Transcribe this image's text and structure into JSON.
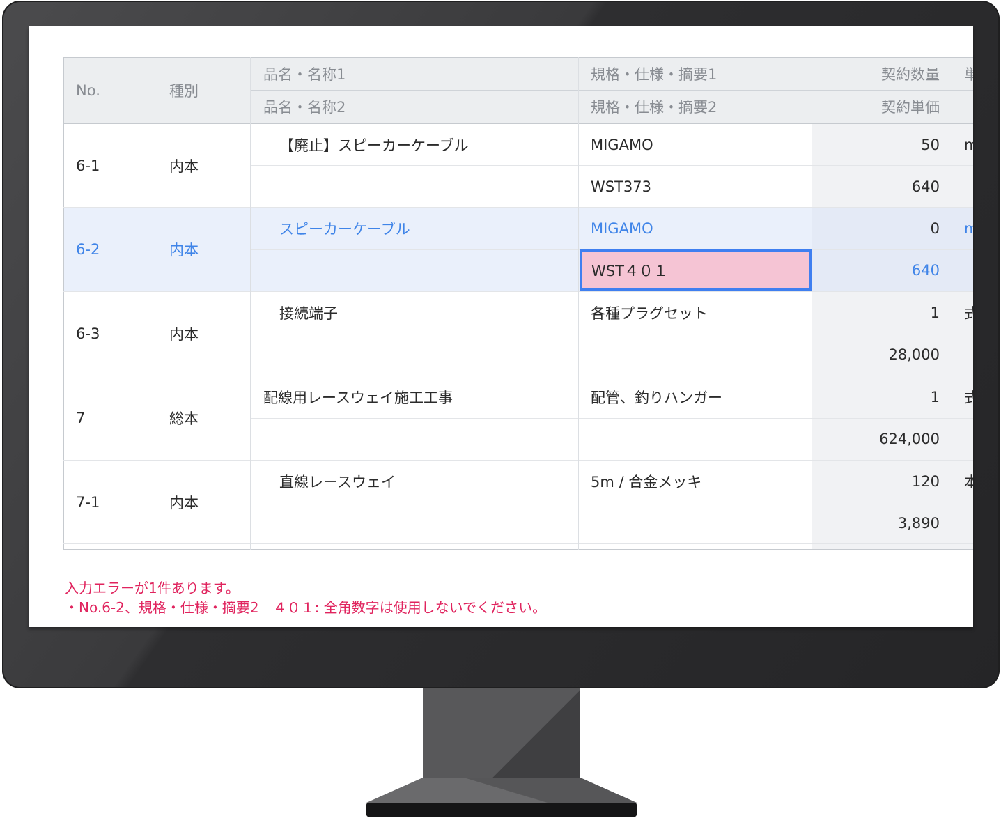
{
  "table": {
    "headers": {
      "no": "No.",
      "type": "種別",
      "name1": "品名・名称1",
      "name2": "品名・名称2",
      "spec1": "規格・仕様・摘要1",
      "spec2": "規格・仕様・摘要2",
      "qty": "契約数量",
      "price": "契約単価",
      "unit": "単"
    },
    "rows": [
      {
        "no": "6-1",
        "type": "内本",
        "name1": "【廃止】スピーカーケーブル",
        "name2": "",
        "spec1": "MIGAMO",
        "spec2": "WST373",
        "qty": "50",
        "price": "640",
        "unit": "m"
      },
      {
        "no": "6-2",
        "type": "内本",
        "name1": "スピーカーケーブル",
        "name2": "",
        "spec1": "MIGAMO",
        "spec2": "WST４０１",
        "qty": "0",
        "price": "640",
        "unit": "m"
      },
      {
        "no": "6-3",
        "type": "内本",
        "name1": "接続端子",
        "name2": "",
        "spec1": "各種プラグセット",
        "spec2": "",
        "qty": "1",
        "price": "28,000",
        "unit": "式"
      },
      {
        "no": "7",
        "type": "総本",
        "name1": "配線用レースウェイ施工工事",
        "name2": "",
        "spec1": "配管、釣りハンガー",
        "spec2": "",
        "qty": "1",
        "price": "624,000",
        "unit": "式"
      },
      {
        "no": "7-1",
        "type": "内本",
        "name1": "直線レースウェイ",
        "name2": "",
        "spec1": "5m / 合金メッキ",
        "spec2": "",
        "qty": "120",
        "price": "3,890",
        "unit": "本"
      }
    ]
  },
  "errors": {
    "summary": "入力エラーが1件あります。",
    "detail": "・No.6-2、規格・仕様・摘要2　４０１: 全角数字は使用しないでください。"
  },
  "colors": {
    "selected_text": "#3f84e8",
    "selected_row_bg": "#eaf0fb",
    "error_cell_bg": "#f5c4d4",
    "error_text": "#e0245e",
    "header_bg": "#eceef0",
    "number_col_bg": "#f1f2f4"
  }
}
